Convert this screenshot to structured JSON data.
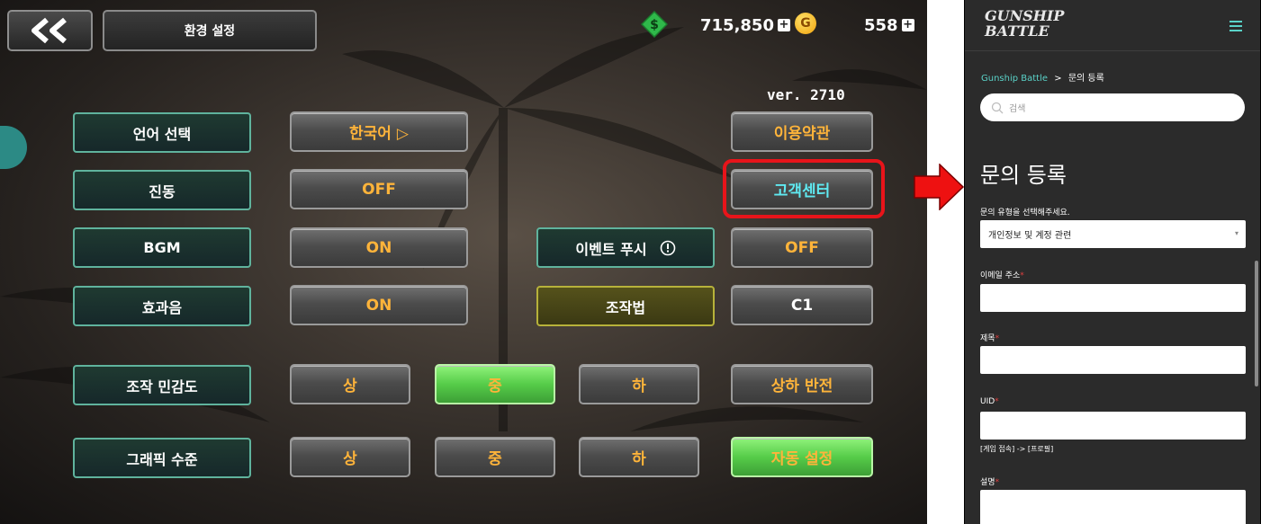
{
  "game": {
    "title": "환경 설정",
    "currency": {
      "cash": "715,850",
      "gold_symbol": "G",
      "gold": "558",
      "plus": "+"
    },
    "version": "ver. 2710",
    "rows": [
      {
        "label": "언어 선택",
        "value": "한국어  ▷"
      },
      {
        "label": "진동",
        "value": "OFF"
      },
      {
        "label": "BGM",
        "value": "ON"
      },
      {
        "label": "효과음",
        "value": "ON"
      },
      {
        "label": "조작 민감도",
        "options": [
          "상",
          "중",
          "하"
        ],
        "selected": "중"
      },
      {
        "label": "그래픽 수준",
        "options": [
          "상",
          "중",
          "하"
        ]
      }
    ],
    "right_buttons": {
      "terms": "이용약관",
      "support": "고객센터",
      "push_label": "이벤트 푸시",
      "push_value": "OFF",
      "controls_label": "조작법",
      "controls_value": "C1",
      "invert": "상하 반전",
      "auto": "자동 설정"
    },
    "colors": {
      "accent_orange": "#ffb43a",
      "highlight_red": "#e8141a",
      "teal_border": "#5fb39d"
    }
  },
  "web": {
    "logo_line1": "GUNSHIP",
    "logo_line2": "BATTLE",
    "breadcrumb": {
      "home": "Gunship Battle",
      "separator": ">",
      "current": "문의 등록"
    },
    "search_placeholder": "검색",
    "page_title": "문의 등록",
    "type_label": "문의 유형을 선택해주세요.",
    "type_value": "개인정보 및 계정 관련",
    "email_label": "이메일 주소",
    "subject_label": "제목",
    "uid_label": "UID",
    "uid_hint": "[게임 접속] -> [프로필]",
    "desc_label": "설명",
    "required_mark": "*",
    "colors": {
      "teal": "#5ad2c8",
      "bg": "#2b2b2b"
    }
  }
}
